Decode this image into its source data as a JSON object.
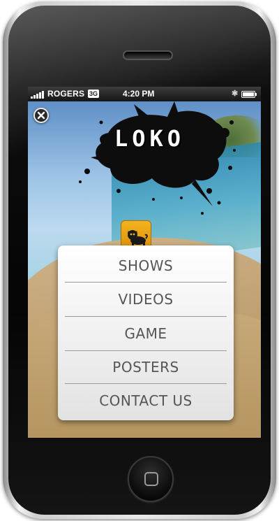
{
  "status_bar": {
    "carrier": "ROGERS",
    "network": "3G",
    "time": "4:20 PM"
  },
  "app": {
    "logo_text": "LOKO",
    "menu": [
      {
        "label": "SHOWS"
      },
      {
        "label": "VIDEOS"
      },
      {
        "label": "GAME"
      },
      {
        "label": "POSTERS"
      },
      {
        "label": "CONTACT US"
      }
    ]
  },
  "icons": {
    "close": "close-icon",
    "app_badge": "pug-icon",
    "home": "home-button",
    "bluetooth": "bluetooth-icon",
    "battery": "battery-icon",
    "signal": "signal-icon"
  },
  "colors": {
    "badge": "#f3b21f",
    "menu_text": "#555555",
    "status_bar": "#1f1f1f"
  }
}
